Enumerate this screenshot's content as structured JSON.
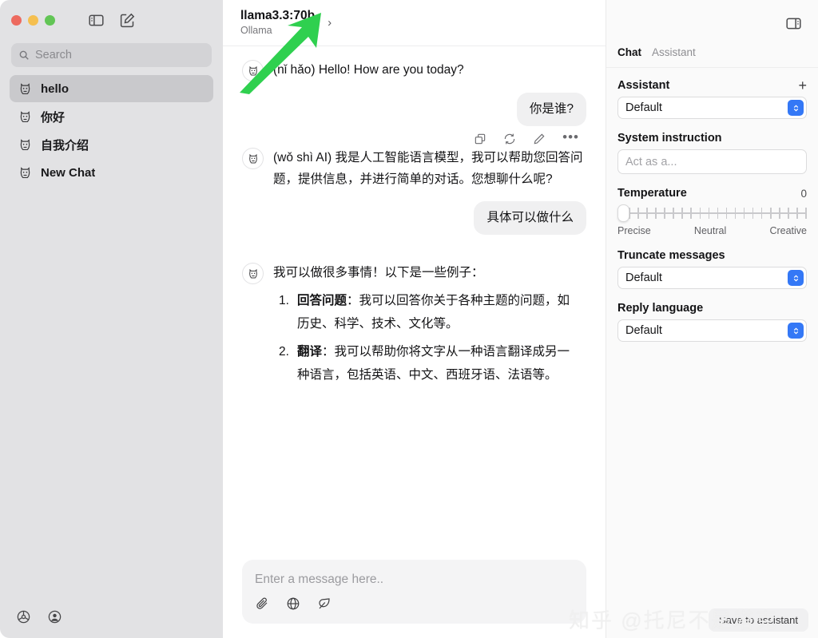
{
  "window": {
    "traffic_lights": [
      "close",
      "minimize",
      "zoom"
    ],
    "toolbar_icons": [
      "sidebar-toggle-icon",
      "new-chat-icon"
    ]
  },
  "sidebar": {
    "search": {
      "placeholder": "Search",
      "value": "",
      "icon": "search-icon"
    },
    "items": [
      {
        "label": "hello",
        "icon": "llama-icon",
        "active": true
      },
      {
        "label": "你好",
        "icon": "llama-icon",
        "active": false
      },
      {
        "label": "自我介绍",
        "icon": "llama-icon",
        "active": false
      },
      {
        "label": "New Chat",
        "icon": "llama-icon",
        "active": false
      }
    ],
    "bottom_icons": [
      "settings-gear-icon",
      "account-icon"
    ]
  },
  "header": {
    "model_name": "llama3.3:70b",
    "provider": "Ollama",
    "chevron": "›",
    "panel_toggle_icon": "right-panel-toggle-icon"
  },
  "conversation": {
    "messages": [
      {
        "role": "assistant",
        "text": "(nǐ hǎo) Hello! How are you today?"
      },
      {
        "role": "user",
        "text": "你是谁?"
      },
      {
        "role": "assistant",
        "text": "(wǒ shì AI) 我是人工智能语言模型，我可以帮助您回答问题，提供信息，并进行简单的对话。您想聊什么呢?"
      },
      {
        "role": "user",
        "text": "具体可以做什么"
      },
      {
        "role": "assistant",
        "text": "我可以做很多事情！以下是一些例子："
      }
    ],
    "actions": [
      "copy-icon",
      "regenerate-icon",
      "edit-icon",
      "more-icon"
    ],
    "list_items": [
      {
        "number": "1.",
        "bold": "回答问题",
        "rest": "：我可以回答你关于各种主题的问题，如历史、科学、技术、文化等。"
      },
      {
        "number": "2.",
        "bold": "翻译",
        "rest": "：我可以帮助你将文字从一种语言翻译成另一种语言，包括英语、中文、西班牙语、法语等。"
      }
    ],
    "scroll_button_icon": "arrow-down-icon"
  },
  "composer": {
    "placeholder": "Enter a message here..",
    "value": "",
    "tools": [
      "attachment-icon",
      "globe-icon",
      "leaf-icon"
    ]
  },
  "right_panel": {
    "tabs": [
      {
        "label": "Chat",
        "active": true
      },
      {
        "label": "Assistant",
        "active": false
      }
    ],
    "assistant": {
      "label": "Assistant",
      "add_label": "+",
      "selected": "Default"
    },
    "system_instruction": {
      "label": "System instruction",
      "placeholder": "Act as a...",
      "value": ""
    },
    "temperature": {
      "label": "Temperature",
      "value": "0",
      "min_label": "Precise",
      "mid_label": "Neutral",
      "max_label": "Creative",
      "position_percent": 0,
      "tick_count": 21
    },
    "truncate_messages": {
      "label": "Truncate messages",
      "selected": "Default"
    },
    "reply_language": {
      "label": "Reply language",
      "selected": "Default"
    },
    "save_button": "Save to assistant"
  },
  "overlay": {
    "watermark": "知乎 @托尼不是塔克",
    "annotation_arrow_color": "#2fd04f"
  }
}
